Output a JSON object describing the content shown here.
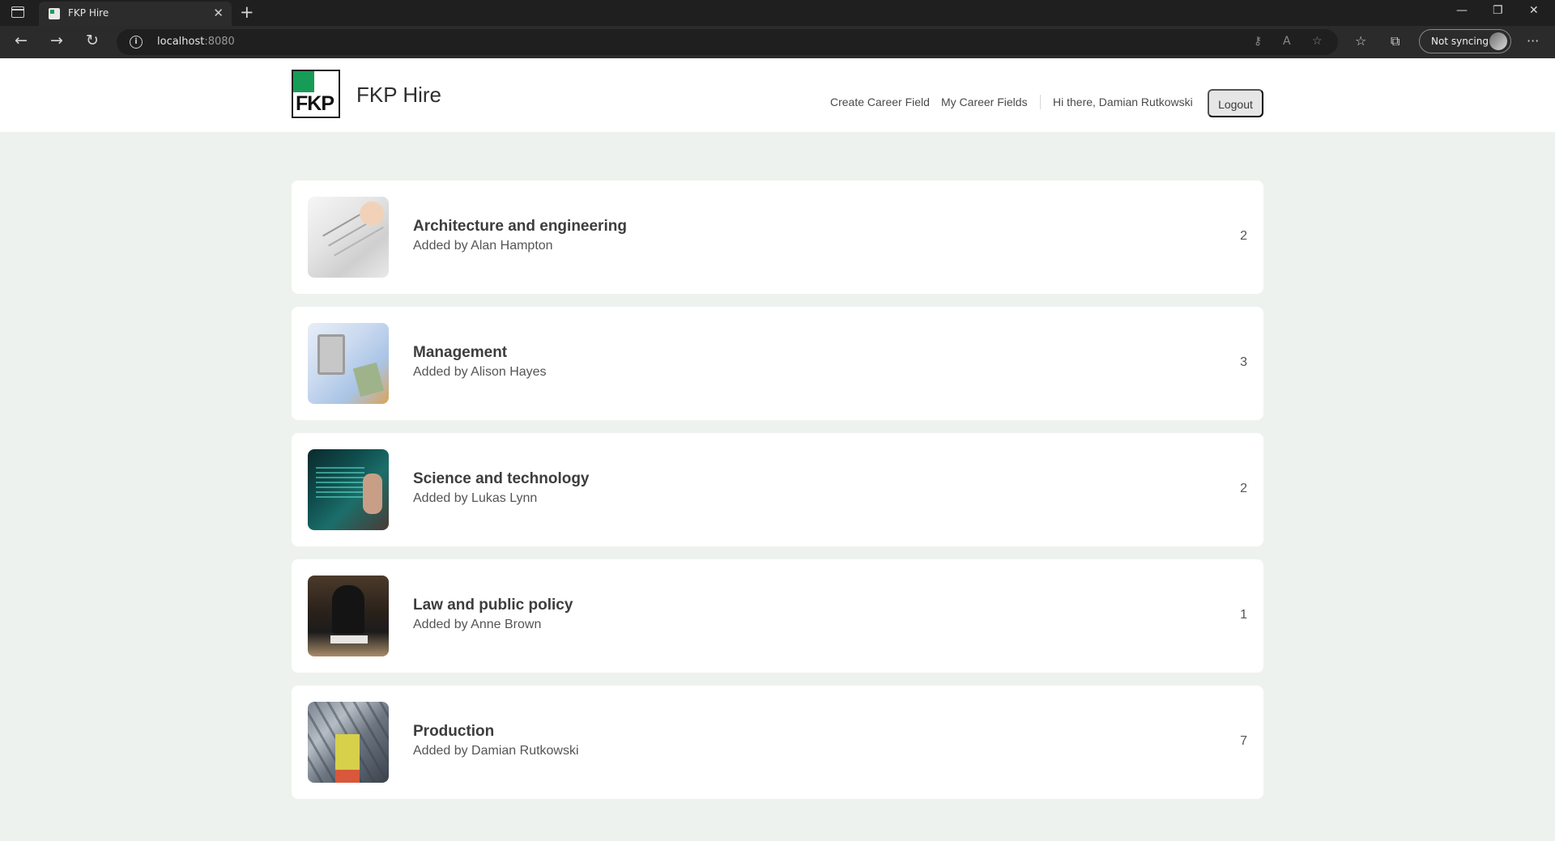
{
  "browser": {
    "tab_title": "FKP Hire",
    "url_host": "localhost",
    "url_port": ":8080",
    "sync_label": "Not syncing"
  },
  "site": {
    "logo_text": "FKP",
    "brand": "FKP Hire",
    "nav": {
      "create": "Create Career Field",
      "mine": "My Career Fields",
      "greeting": "Hi there, Damian Rutkowski",
      "logout": "Logout"
    },
    "accent_color": "#169c56"
  },
  "career_fields": [
    {
      "title": "Architecture and engineering",
      "added_by": "Added by Alan Hampton",
      "count": "2"
    },
    {
      "title": "Management",
      "added_by": "Added by Alison Hayes",
      "count": "3"
    },
    {
      "title": "Science and technology",
      "added_by": "Added by Lukas Lynn",
      "count": "2"
    },
    {
      "title": "Law and public policy",
      "added_by": "Added by Anne Brown",
      "count": "1"
    },
    {
      "title": "Production",
      "added_by": "Added by Damian Rutkowski",
      "count": "7"
    }
  ]
}
